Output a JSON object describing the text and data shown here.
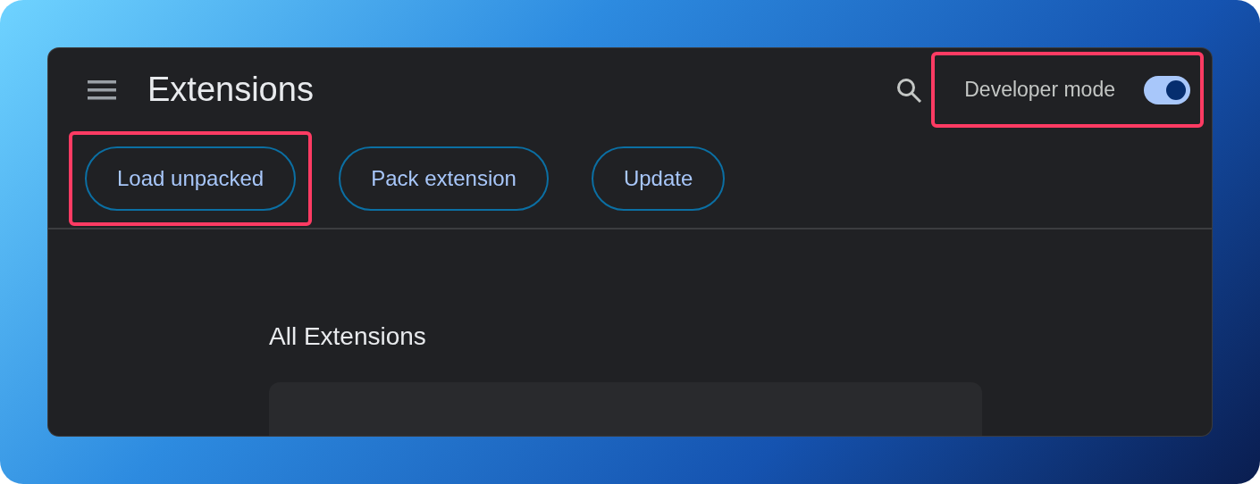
{
  "header": {
    "title": "Extensions",
    "developer_mode": {
      "label": "Developer mode",
      "on": true,
      "highlighted": true
    }
  },
  "actions": [
    {
      "label": "Load unpacked",
      "highlighted": true
    },
    {
      "label": "Pack extension",
      "highlighted": false
    },
    {
      "label": "Update",
      "highlighted": false
    }
  ],
  "section": {
    "title": "All Extensions"
  }
}
